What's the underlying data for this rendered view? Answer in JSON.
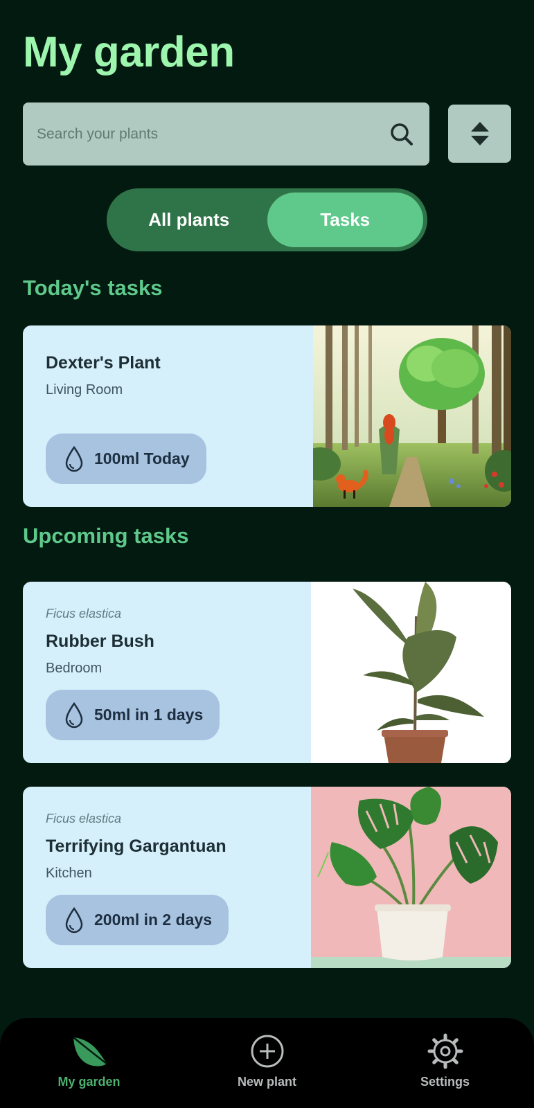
{
  "header": {
    "title": "My garden"
  },
  "search": {
    "placeholder": "Search your plants"
  },
  "toggle": {
    "options": [
      "All plants",
      "Tasks"
    ],
    "active": "Tasks"
  },
  "sections": {
    "today": "Today's tasks",
    "upcoming": "Upcoming tasks"
  },
  "tasks": {
    "today": [
      {
        "species": "",
        "name": "Dexter's Plant",
        "room": "Living Room",
        "water": "100ml Today",
        "image": "fantasy-forest-girl-fox-image"
      }
    ],
    "upcoming": [
      {
        "species": "Ficus elastica",
        "name": "Rubber Bush",
        "room": "Bedroom",
        "water": "50ml in 1 days",
        "image": "rubber-plant-photo"
      },
      {
        "species": "Ficus elastica",
        "name": "Terrifying Gargantuan",
        "room": "Kitchen",
        "water": "200ml in 2 days",
        "image": "monstera-plant-photo"
      }
    ]
  },
  "nav": {
    "items": [
      {
        "label": "My garden",
        "icon": "leaf-icon",
        "active": true
      },
      {
        "label": "New plant",
        "icon": "plus-circle-icon",
        "active": false
      },
      {
        "label": "Settings",
        "icon": "gear-icon",
        "active": false
      }
    ]
  },
  "colors": {
    "background": "#021a10",
    "title": "#9df5ae",
    "accent": "#5fc98b",
    "card": "#d5f0fb",
    "chip": "#a8c3e0",
    "search": "#b0cac2"
  }
}
